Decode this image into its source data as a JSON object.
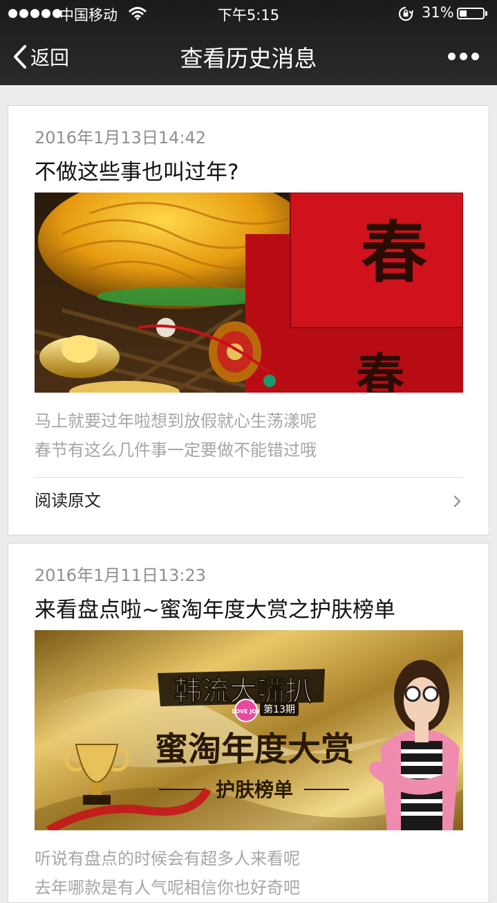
{
  "status_bar": {
    "carrier": "中国移动",
    "time": "下午5:15",
    "battery_percent": "31%",
    "battery_level": 0.31
  },
  "nav": {
    "back_label": "返回",
    "title": "查看历史消息"
  },
  "articles": [
    {
      "date": "2016年1月13日14:42",
      "title": "不做这些事也叫过年?",
      "digest_line1": "马上就要过年啦想到放假就心生荡漾呢",
      "digest_line2": "春节有这么几件事一定要做不能错过哦",
      "read_more": "阅读原文",
      "cover": {
        "char1": "春",
        "char2": "春"
      }
    },
    {
      "date": "2016年1月11日13:23",
      "title": "来看盘点啦~蜜淘年度大赏之护肤榜单",
      "digest_line1": "听说有盘点的时候会有超多人来看呢",
      "digest_line2": "去年哪款是有人气呢相信你也好奇吧",
      "cover": {
        "headline": "韩流大嘴扒",
        "badge": "LOVE JOY",
        "issue": "第13期",
        "main_title": "蜜淘年度大赏",
        "subtitle": "护肤榜单"
      }
    }
  ],
  "colors": {
    "nav_bg": "#1b1b1b",
    "page_bg": "#ececec",
    "envelope_red": "#c8101a",
    "gold": "#d6ae4a"
  }
}
